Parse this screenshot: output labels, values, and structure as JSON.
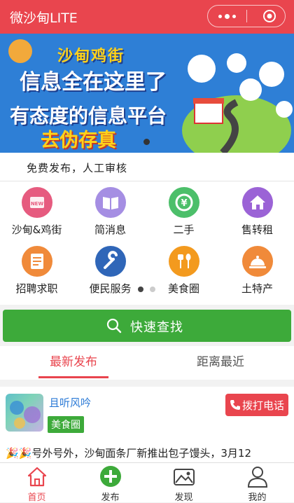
{
  "app": {
    "title": "微沙甸LITE"
  },
  "banner": {
    "brand": "沙甸鸡街",
    "line1": "信息全在这里了",
    "line2": "有态度的信息平台",
    "line3": "去伪存真"
  },
  "notice": "免费发布，人工审核",
  "categories": [
    {
      "label": "沙甸&鸡街",
      "icon": "new-badge-icon",
      "color": "#e65b7f"
    },
    {
      "label": "简消息",
      "icon": "book-icon",
      "color": "#a58ee3"
    },
    {
      "label": "二手",
      "icon": "recycle-yen-icon",
      "color": "#4cbf6a"
    },
    {
      "label": "售转租",
      "icon": "house-icon",
      "color": "#9b63d6"
    },
    {
      "label": "招聘求职",
      "icon": "document-icon",
      "color": "#f08a3a"
    },
    {
      "label": "便民服务",
      "icon": "wrench-icon",
      "color": "#2f66b8"
    },
    {
      "label": "美食圈",
      "icon": "fork-spoon-icon",
      "color": "#f39a1e"
    },
    {
      "label": "土特产",
      "icon": "cloche-icon",
      "color": "#f08a3a"
    }
  ],
  "search": {
    "label": "快速查找"
  },
  "tabs": [
    {
      "label": "最新发布"
    },
    {
      "label": "距离最近"
    }
  ],
  "post": {
    "author": "且听风吟",
    "tag": "美食圈",
    "call_label": "拨打电话",
    "excerpt": "🎉🎉号外号外，沙甸面条厂新推出包子馒头，3月12"
  },
  "tabbar": [
    {
      "label": "首页",
      "icon": "home-icon"
    },
    {
      "label": "发布",
      "icon": "plus-icon"
    },
    {
      "label": "发现",
      "icon": "discover-icon"
    },
    {
      "label": "我的",
      "icon": "user-icon"
    }
  ],
  "colors": {
    "brand": "#e9454e",
    "green": "#3daa3a",
    "link": "#2b7ad6"
  }
}
